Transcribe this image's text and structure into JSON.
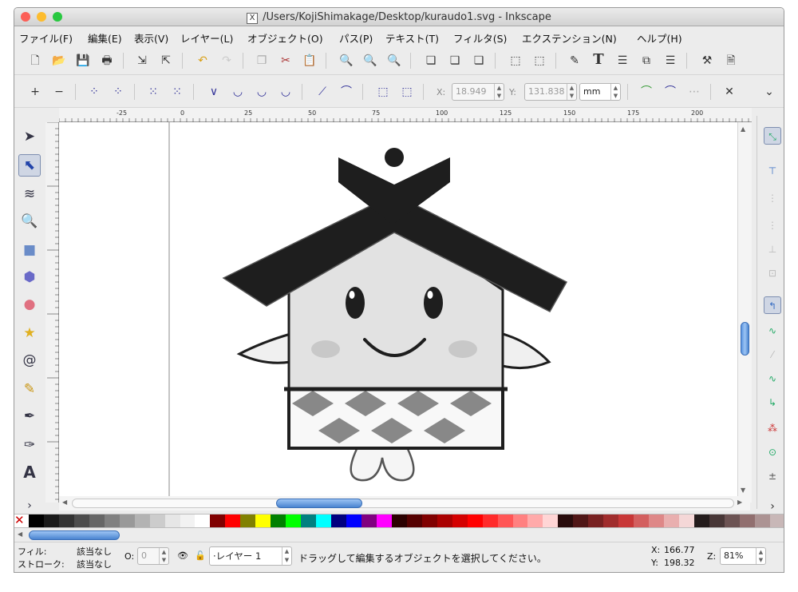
{
  "window": {
    "title": "/Users/KojiShimakage/Desktop/kuraudo1.svg - Inkscape",
    "doc_icon": "X",
    "traffic_lights": [
      "#fc5f57",
      "#fdbc2e",
      "#28c840"
    ]
  },
  "menu": [
    "ファイル(F)",
    "編集(E)",
    "表示(V)",
    "レイヤー(L)",
    "オブジェクト(O)",
    "パス(P)",
    "テキスト(T)",
    "フィルタ(S)",
    "エクステンション(N)",
    "ヘルプ(H)"
  ],
  "commands_bar": {
    "icons": [
      "new-icon",
      "open-icon",
      "save-icon",
      "print-icon",
      "import-icon",
      "export-icon",
      "undo-icon",
      "redo-icon",
      "duplicate-icon",
      "cut-icon",
      "paste-icon",
      "zoom-selection-icon",
      "zoom-drawing-icon",
      "zoom-page-icon",
      "group-icon",
      "ungroup-icon",
      "clone-icon",
      "raise-icon",
      "lower-icon",
      "fill-stroke-icon",
      "text-font-icon",
      "layers-icon",
      "xml-editor-icon",
      "align-icon",
      "preferences-icon",
      "document-properties-icon"
    ],
    "text_tool_glyph": "T"
  },
  "controls_bar": {
    "x_label": "X:",
    "x_value": "18.949",
    "y_label": "Y:",
    "y_value": "131.838",
    "unit": "mm",
    "overflow_glyph": "⌄"
  },
  "ruler": {
    "top_labels": [
      "-25",
      "0",
      "25",
      "50",
      "75",
      "100",
      "125",
      "150",
      "175",
      "200"
    ]
  },
  "tools": [
    "selector-tool-icon",
    "node-tool-icon",
    "tweak-tool-icon",
    "zoom-tool-icon",
    "rect-tool-icon",
    "3dbox-tool-icon",
    "ellipse-tool-icon",
    "star-tool-icon",
    "spiral-tool-icon",
    "pencil-tool-icon",
    "pen-tool-icon",
    "calligraphy-tool-icon",
    "text-tool-icon"
  ],
  "tool_overflow": "›",
  "snap_overflow": "›",
  "palette": [
    "#000000",
    "#1a1a1a",
    "#333333",
    "#4d4d4d",
    "#666666",
    "#808080",
    "#999999",
    "#b3b3b3",
    "#cccccc",
    "#e6e6e6",
    "#f2f2f2",
    "#ffffff",
    "#800000",
    "#ff0000",
    "#808000",
    "#ffff00",
    "#008000",
    "#00ff00",
    "#008080",
    "#00ffff",
    "#000080",
    "#0000ff",
    "#800080",
    "#ff00ff",
    "#2b0000",
    "#550000",
    "#800000",
    "#aa0000",
    "#d40000",
    "#ff0000",
    "#ff2a2a",
    "#ff5555",
    "#ff8080",
    "#ffaaaa",
    "#ffd5d5",
    "#280b0b",
    "#501616",
    "#782121",
    "#a02c2c",
    "#c83737",
    "#d35f5f",
    "#de8787",
    "#e9afaf",
    "#f4d7d7",
    "#241c1c",
    "#483737",
    "#6c5353",
    "#916f6f",
    "#ac9393",
    "#c8b7b7"
  ],
  "status": {
    "fill_label": "フィル:",
    "fill_value": "該当なし",
    "stroke_label": "ストローク:",
    "stroke_value": "該当なし",
    "opacity_label": "O:",
    "opacity_value": "0",
    "layer": "·レイヤー 1",
    "message": "ドラッグして編集するオブジェクトを選択してください。",
    "x_label": "X:",
    "x_coord": "166.77",
    "y_label": "Y:",
    "y_coord": "198.32",
    "zoom_label": "Z:",
    "zoom": "81%"
  },
  "artwork": {
    "roof_color": "#1e1e1e",
    "wall_color": "#e2e2e2",
    "cheek_color": "#c8c8c8",
    "diamond_color": "#888888"
  }
}
